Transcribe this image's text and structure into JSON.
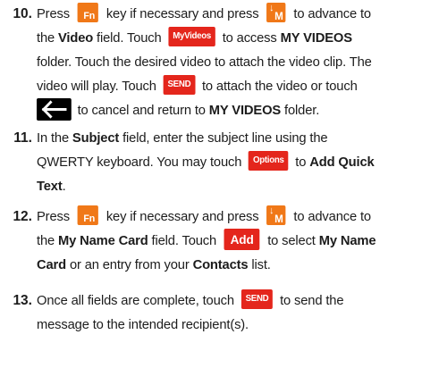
{
  "icons": {
    "fn_key": "Fn",
    "down_m_key": "M",
    "down_arrow": "↓",
    "my_videos_button": "MyVideos",
    "send_button": "SEND",
    "options_button": "Options",
    "add_button": "Add"
  },
  "colors": {
    "icon_orange": "#f07818",
    "icon_red": "#e4261c",
    "icon_black": "#000000"
  },
  "steps": [
    {
      "number": "10.",
      "line1": {
        "t1": "Press ",
        "t2": " key if necessary and press ",
        "t3": " to advance to"
      },
      "line2": {
        "t1": "the ",
        "b1": "Video",
        "t2": " field. Touch ",
        "t3": " to access ",
        "b2": "MY VIDEOS"
      },
      "line3": {
        "t1": "folder. Touch the desired video to attach the video clip. The"
      },
      "line4": {
        "t1": "video will play. Touch ",
        "t2": " to attach the video or touch"
      },
      "line5": {
        "t1": "to cancel and return to ",
        "b1": "MY VIDEOS",
        "t2": " folder."
      }
    },
    {
      "number": "11.",
      "line1": {
        "t1": "In the ",
        "b1": "Subject",
        "t2": " field, enter the subject line using the"
      },
      "line2": {
        "t1": "QWERTY keyboard. You may touch ",
        "t2": " to ",
        "b1": "Add Quick"
      },
      "line3": {
        "b1": "Text",
        "t1": "."
      }
    },
    {
      "number": "12.",
      "line1": {
        "t1": "Press ",
        "t2": " key if necessary and press ",
        "t3": " to advance to"
      },
      "line2": {
        "t1": "the ",
        "b1": "My Name Card",
        "t2": " field. Touch ",
        "t3": " to select ",
        "b2": "My Name"
      },
      "line3": {
        "b1": "Card",
        "t1": " or an entry from your ",
        "b2": "Contacts",
        "t2": " list."
      }
    },
    {
      "number": "13.",
      "line1": {
        "t1": "Once all fields are complete, touch ",
        "t2": " to send the"
      },
      "line2": {
        "t1": "message to the intended recipient(s)."
      }
    }
  ]
}
